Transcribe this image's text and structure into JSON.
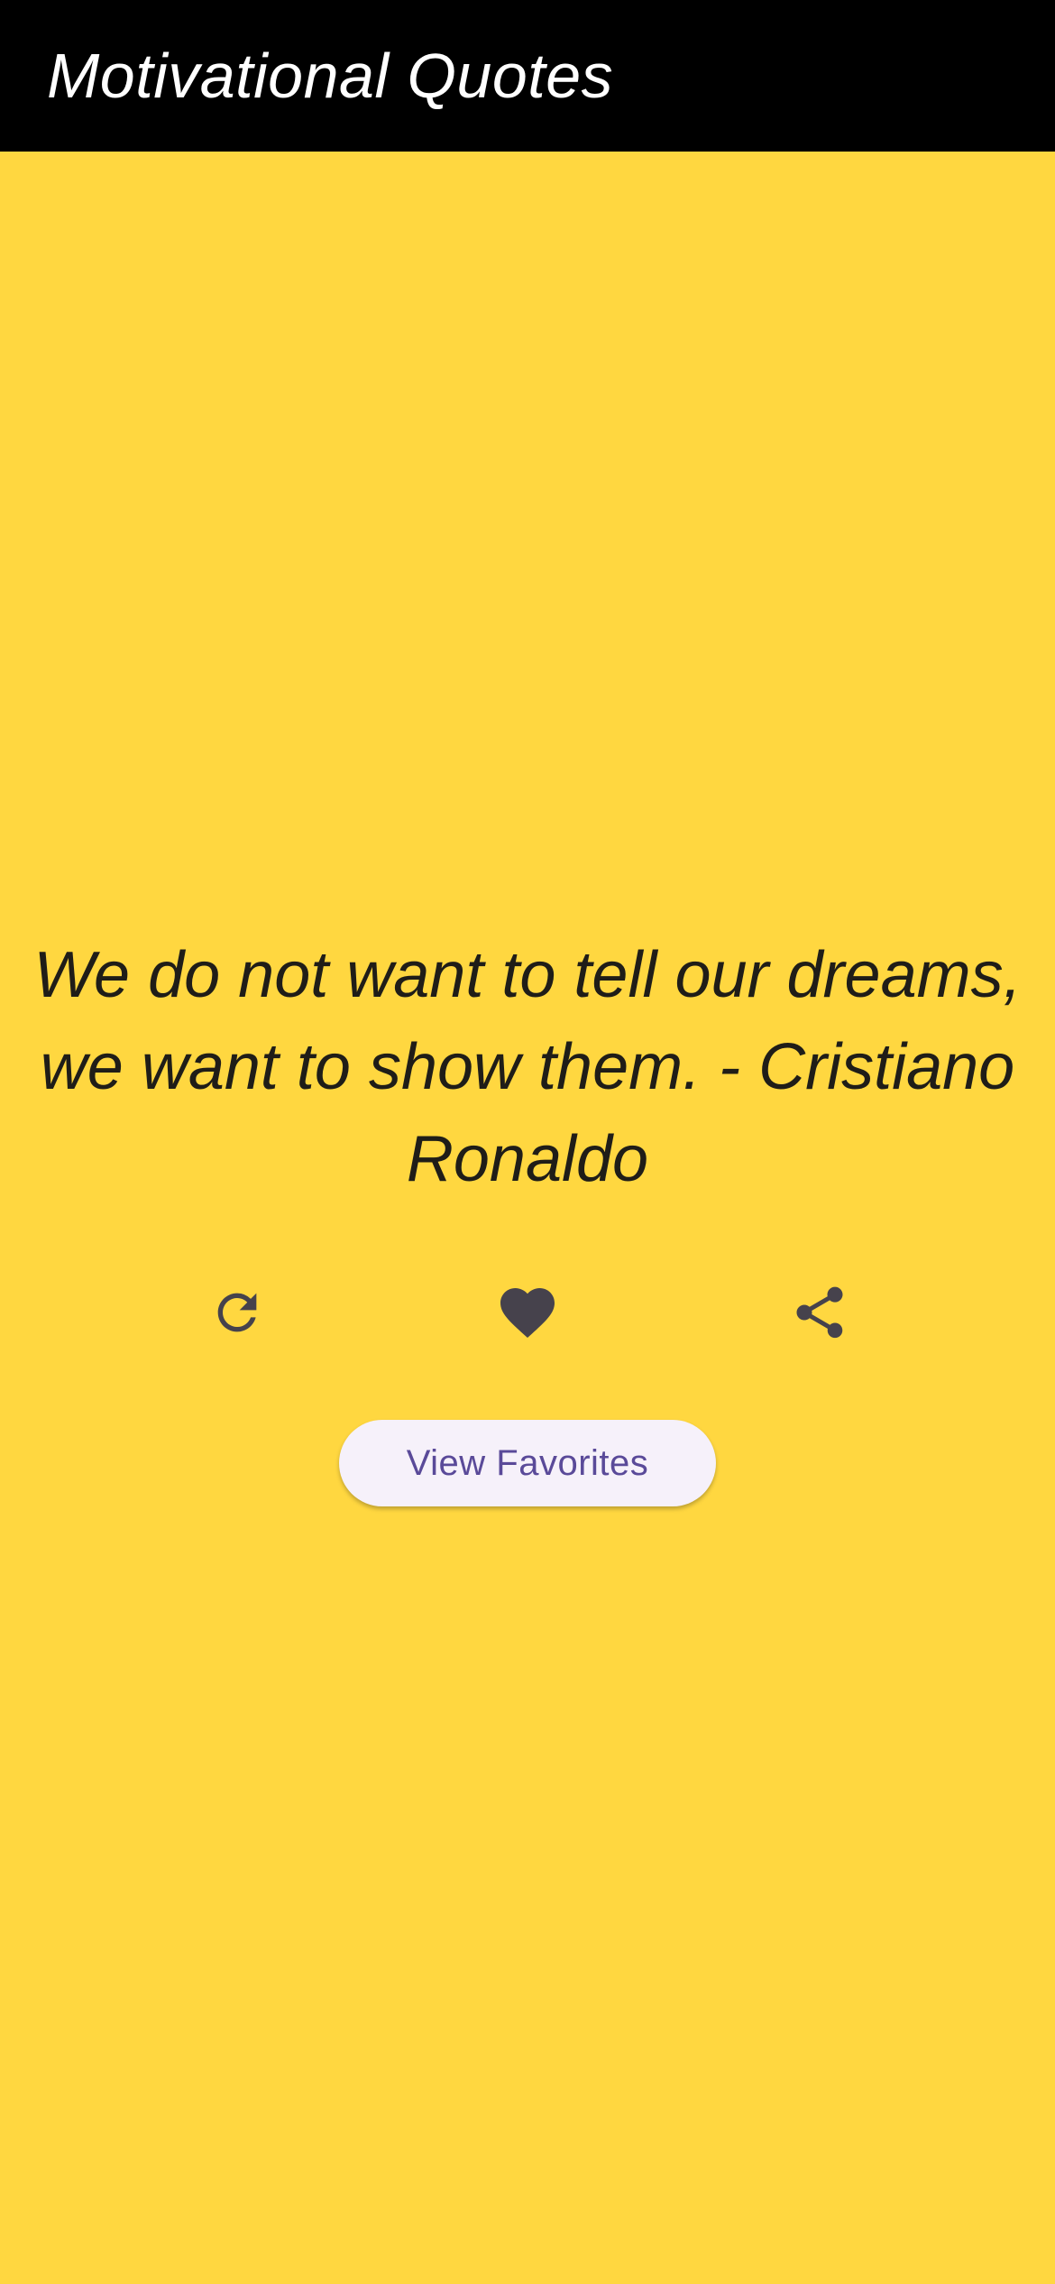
{
  "app_bar": {
    "title": "Motivational Quotes"
  },
  "quote": {
    "text": "We do not want to tell our dreams, we want to show them. - Cristiano Ronaldo"
  },
  "actions": [
    {
      "name": "refresh",
      "icon": "refresh-icon"
    },
    {
      "name": "favorite",
      "icon": "heart-icon"
    },
    {
      "name": "share",
      "icon": "share-icon"
    }
  ],
  "favorites_button": {
    "label": "View Favorites"
  },
  "colors": {
    "background": "#FFD740",
    "app_bar": "#000000",
    "icon": "#46424C",
    "button_bg": "#F6F1FA",
    "button_text": "#5A4A99"
  }
}
